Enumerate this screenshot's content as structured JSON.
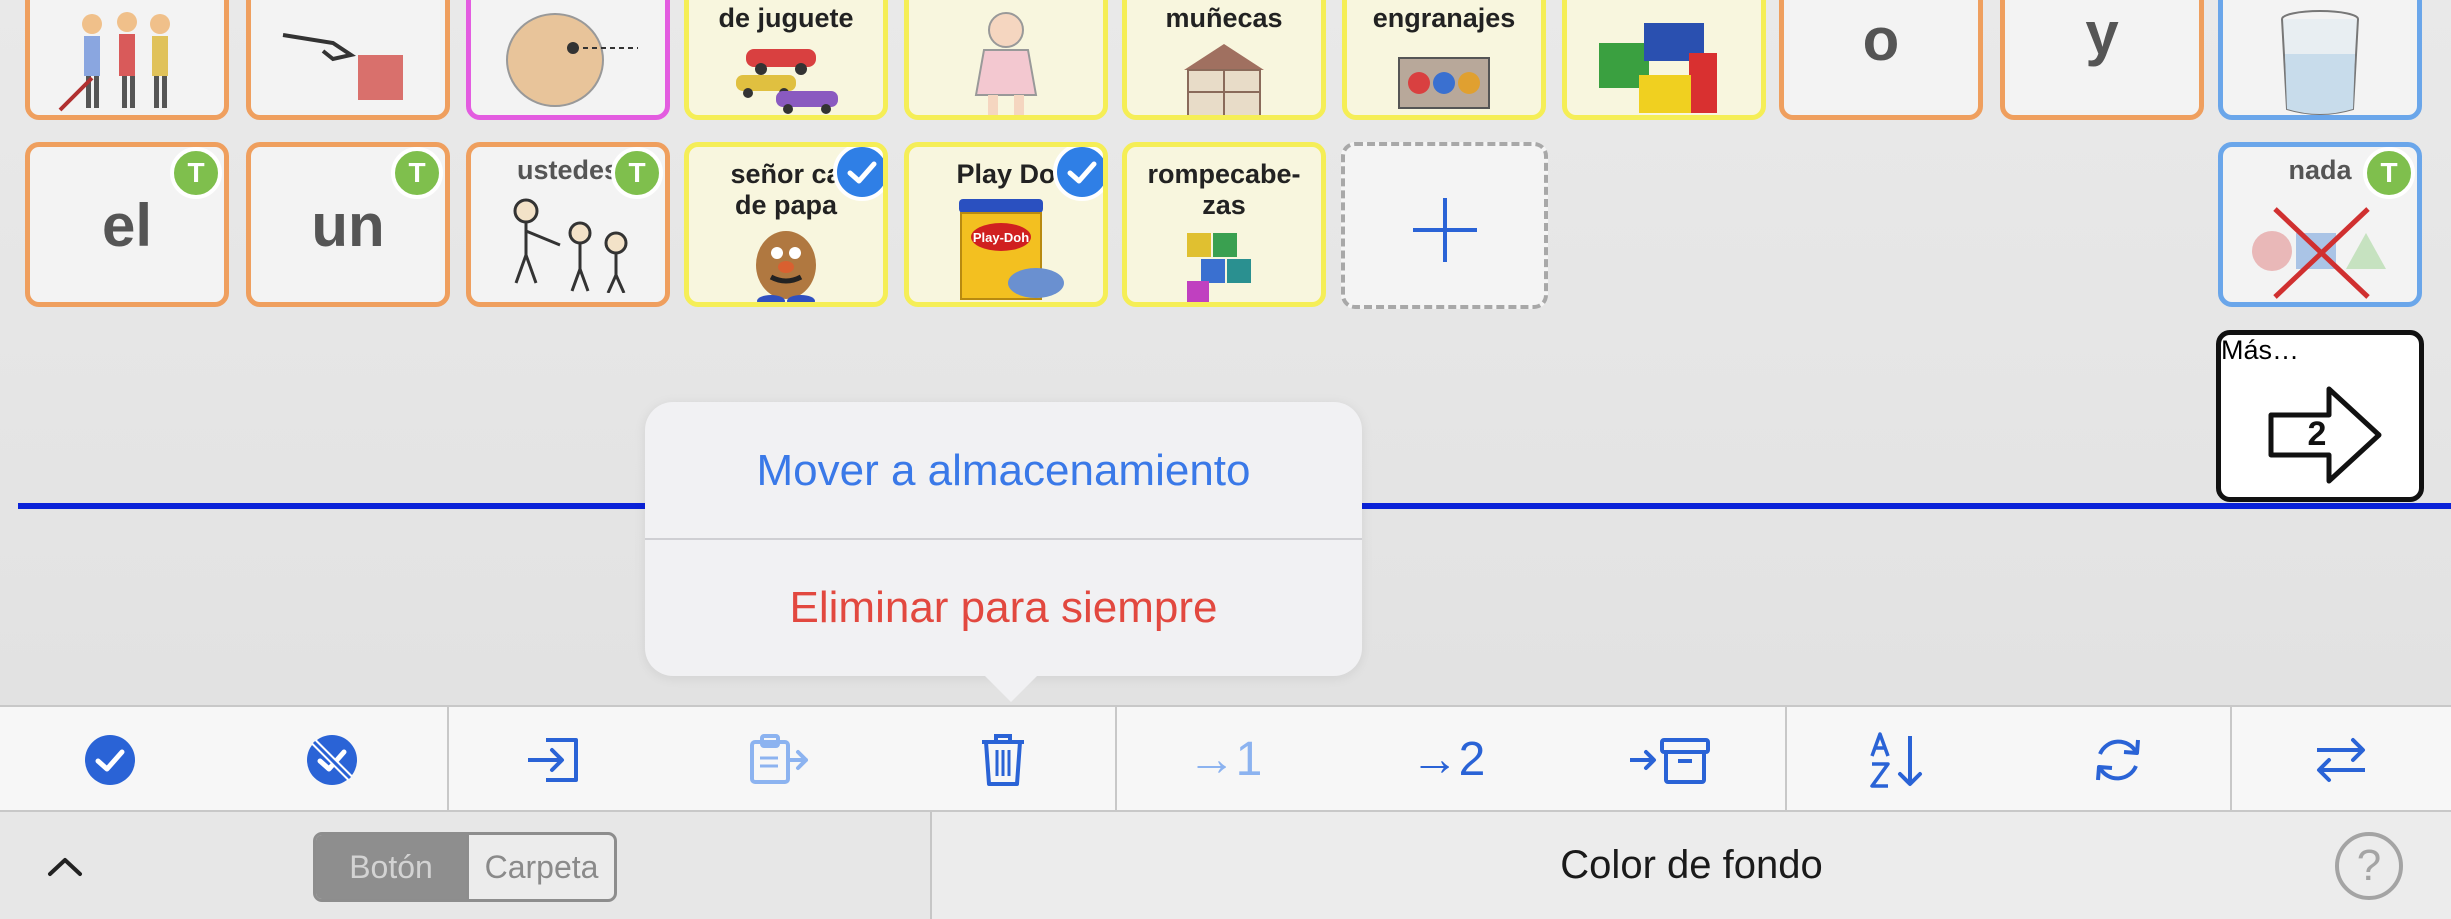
{
  "tiles_top": [
    {
      "label": ""
    },
    {
      "label": ""
    },
    {
      "label": ""
    },
    {
      "label": "de juguete"
    },
    {
      "label": ""
    },
    {
      "label": "muñecas"
    },
    {
      "label": "engranajes"
    },
    {
      "label": ""
    },
    {
      "word": "o"
    },
    {
      "word": "y"
    },
    {
      "label": ""
    }
  ],
  "tiles_row2": {
    "el": "el",
    "un": "un",
    "ustedes": "ustedes",
    "senor_line1": "señor ca",
    "senor_line2": "de papa",
    "playdoh": "Play Do",
    "rompe_line1": "rompeca­be-",
    "rompe_line2": "zas",
    "nada": "nada"
  },
  "badges": {
    "t": "T"
  },
  "playdoh_logo": "Play-Doh",
  "more": {
    "label": "Más…",
    "page": "2"
  },
  "popover": {
    "move_label": "Mover a almacenamiento",
    "delete_label": "Eliminar para siempre"
  },
  "toolbar": {
    "arrow1": "→1",
    "arrow2": "→2"
  },
  "bottom": {
    "seg_on": "Botón",
    "seg_off": "Carpeta",
    "title": "Color de fondo",
    "help": "?"
  },
  "colors": {
    "accent": "#2a63d6",
    "delete": "#e2483f",
    "divider_line": "#0a22d8",
    "orange_border": "#ef9f5e",
    "yellow_border": "#f5ee56",
    "blue_border": "#6aa6ea",
    "pink_border": "#e35ce0",
    "badge_green": "#7fbf4d"
  }
}
